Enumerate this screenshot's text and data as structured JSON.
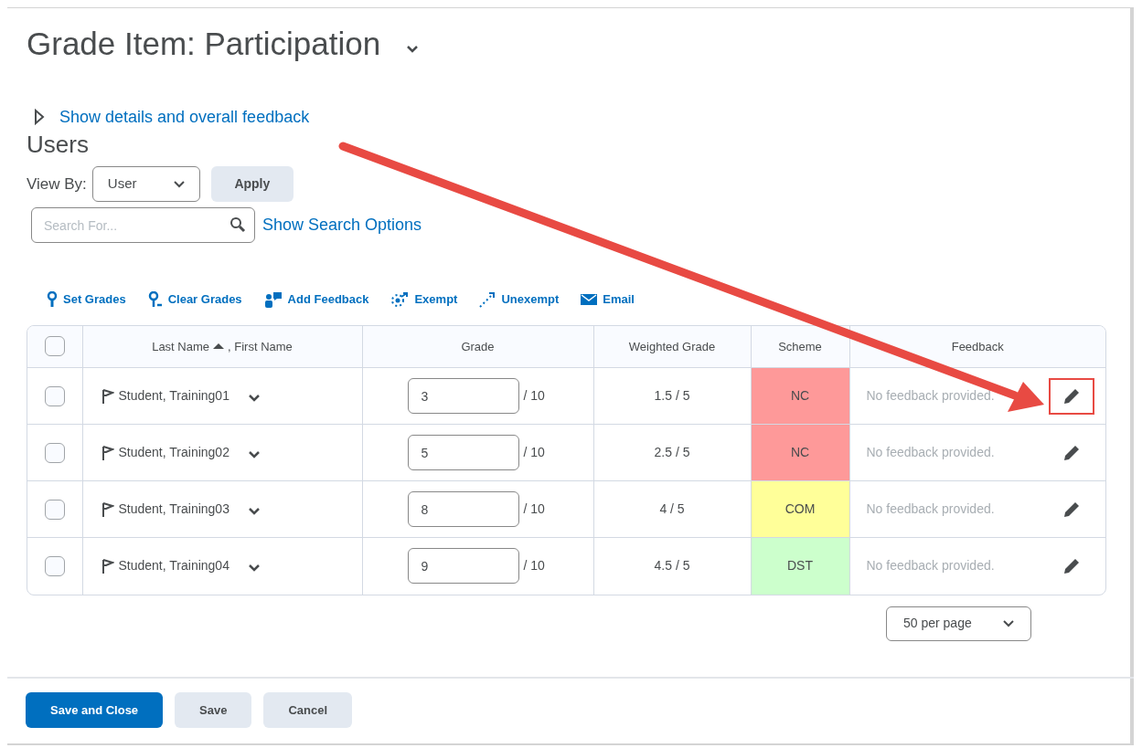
{
  "page": {
    "title": "Grade Item: Participation"
  },
  "details_link": "Show details and overall feedback",
  "section_title": "Users",
  "view_by": {
    "label": "View By:",
    "value": "User",
    "apply": "Apply"
  },
  "search": {
    "placeholder": "Search For...",
    "options_link": "Show Search Options"
  },
  "actions": [
    {
      "kind": "set",
      "label": "Set Grades"
    },
    {
      "kind": "clear",
      "label": "Clear Grades"
    },
    {
      "kind": "feedback",
      "label": "Add Feedback"
    },
    {
      "kind": "exempt",
      "label": "Exempt"
    },
    {
      "kind": "unexempt",
      "label": "Unexempt"
    },
    {
      "kind": "email",
      "label": "Email"
    }
  ],
  "table": {
    "columns": [
      {
        "label": "Last Name",
        "sorted_ascending": true,
        "secondary": ", First Name"
      },
      {
        "label": "Grade"
      },
      {
        "label": "Weighted Grade"
      },
      {
        "label": "Scheme"
      },
      {
        "label": "Feedback"
      }
    ],
    "select_all_checked": false,
    "rows": [
      {
        "checked": false,
        "name": "Student, Training01",
        "grade": "3",
        "out_of": "/ 10",
        "weighted": "1.5 / 5",
        "scheme": "NC",
        "color": "#fe9999",
        "feedback": "No feedback provided.",
        "highlighted": true
      },
      {
        "checked": false,
        "name": "Student, Training02",
        "grade": "5",
        "out_of": "/ 10",
        "weighted": "2.5 / 5",
        "scheme": "NC",
        "color": "#fe9999",
        "feedback": "No feedback provided.",
        "highlighted": false
      },
      {
        "checked": false,
        "name": "Student, Training03",
        "grade": "8",
        "out_of": "/ 10",
        "weighted": "4 / 5",
        "scheme": "COM",
        "color": "#ffff99",
        "feedback": "No feedback provided.",
        "highlighted": false
      },
      {
        "checked": false,
        "name": "Student, Training04",
        "grade": "9",
        "out_of": "/ 10",
        "weighted": "4.5 / 5",
        "scheme": "DST",
        "color": "#ccffcc",
        "feedback": "No feedback provided.",
        "highlighted": false
      }
    ]
  },
  "per_page": "50 per page",
  "buttons": [
    {
      "kind": "primary",
      "label": "Save and Close"
    },
    {
      "kind": "secondary",
      "label": "Save"
    },
    {
      "kind": "secondary",
      "label": "Cancel"
    }
  ]
}
